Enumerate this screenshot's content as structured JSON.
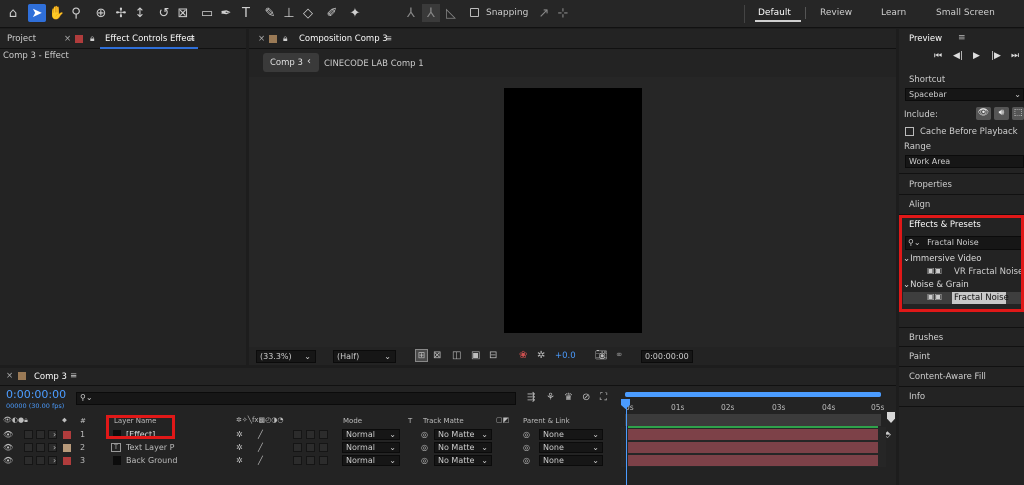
{
  "toolbar": {
    "snapping_label": "Snapping",
    "workspaces": [
      "Default",
      "Review",
      "Learn",
      "Small Screen"
    ],
    "active_workspace": "Default"
  },
  "left_panel": {
    "tab_project": "Project",
    "tab_effect_controls": "Effect Controls Effect",
    "subtitle": "Comp 3 - Effect"
  },
  "comp_panel": {
    "tab_title": "Composition Comp 3",
    "breadcrumb_current": "Comp 3",
    "breadcrumb_next": "CINECODE LAB Comp 1",
    "zoom": "(33.3%)",
    "resolution": "(Half)",
    "exposure": "+0.0",
    "timecode": "0:00:00:00"
  },
  "right_panel": {
    "preview_title": "Preview",
    "shortcut_label": "Shortcut",
    "shortcut_value": "Spacebar",
    "include_label": "Include:",
    "cache_label": "Cache Before Playback",
    "range_label": "Range",
    "range_value": "Work Area",
    "properties": "Properties",
    "align": "Align",
    "effects_title": "Effects & Presets",
    "search_value": "Fractal Noise",
    "categories": [
      {
        "name": "Immersive Video",
        "item": "VR Fractal Noise"
      },
      {
        "name": "Noise & Grain",
        "item": "Fractal Noise"
      }
    ],
    "brushes": "Brushes",
    "paint": "Paint",
    "content_aware_fill": "Content-Aware Fill",
    "info": "Info"
  },
  "timeline": {
    "tab_title": "Comp 3",
    "current_time": "0:00:00:00",
    "frame_info": "00000 (30.00 fps)",
    "headers": {
      "hash": "#",
      "layer_name": "Layer Name",
      "mode": "Mode",
      "t": "T",
      "track_matte": "Track Matte",
      "parent_link": "Parent & Link"
    },
    "ruler": [
      "0s",
      "01s",
      "02s",
      "03s",
      "04s",
      "05s"
    ],
    "layers": [
      {
        "num": "1",
        "name": "[Effect]",
        "color": "#b03c3c",
        "mode": "Normal",
        "matte": "No Matte",
        "parent": "None"
      },
      {
        "num": "2",
        "name": "Text Layer P",
        "color": "#b89a7a",
        "mode": "Normal",
        "matte": "No Matte",
        "parent": "None"
      },
      {
        "num": "3",
        "name": "Back Ground",
        "color": "#b03c3c",
        "mode": "Normal",
        "matte": "No Matte",
        "parent": "None"
      }
    ]
  },
  "colors": {
    "accent_blue": "#2f6fd9",
    "highlight_red": "#e01818",
    "layer_bar": "#7d4148"
  }
}
